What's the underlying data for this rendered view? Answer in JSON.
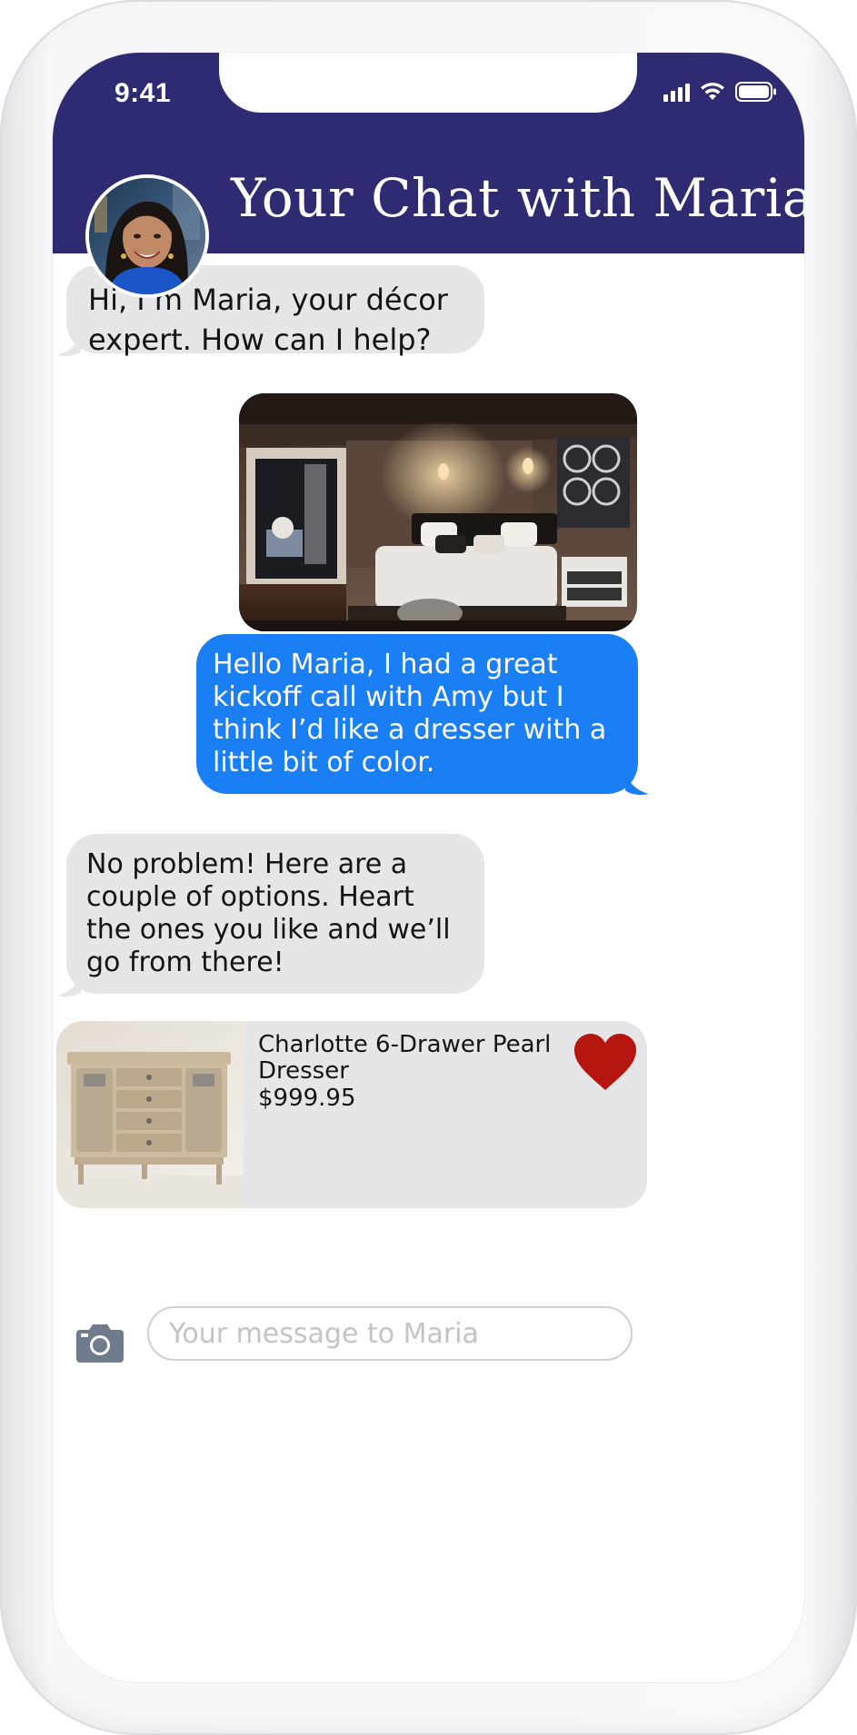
{
  "status_bar": {
    "time": "9:41"
  },
  "header": {
    "title": "Your Chat with Maria",
    "avatar_icon": "maria-avatar",
    "background_color": "#2e2b72"
  },
  "messages": [
    {
      "sender": "Maria",
      "direction": "incoming",
      "text": "Hi, I’m Maria, your décor expert. How can I help?"
    },
    {
      "sender": "user",
      "direction": "outgoing",
      "type": "image",
      "image_icon": "bedroom-photo"
    },
    {
      "sender": "user",
      "direction": "outgoing",
      "text": "Hello Maria, I had a great kickoff call with Amy but I think I’d like a dresser with a little bit of color."
    },
    {
      "sender": "Maria",
      "direction": "incoming",
      "text": "No problem! Here are a couple of options. Heart the ones you like and we’ll go from there!"
    }
  ],
  "product": {
    "name": "Charlotte 6-Drawer Pearl Dresser",
    "price": "$999.95",
    "image_icon": "dresser-photo",
    "favorite_icon": "heart-icon",
    "favorite_color": "#b5160f",
    "favorited": true
  },
  "composer": {
    "camera_icon": "camera-icon",
    "placeholder": "Your message to Maria"
  },
  "colors": {
    "incoming_bubble": "#e6e6e8",
    "outgoing_bubble": "#1a7ff5",
    "header": "#2e2b72"
  }
}
